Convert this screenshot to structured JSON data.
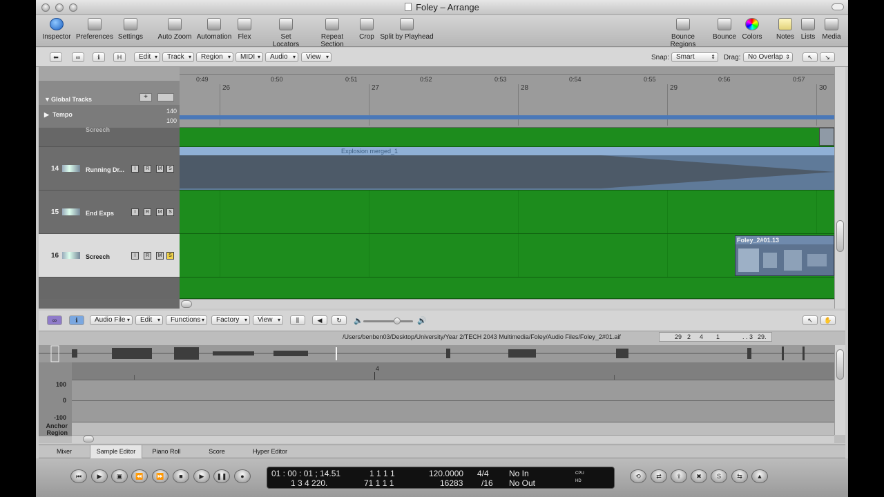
{
  "window": {
    "title": "Foley – Arrange"
  },
  "toolbar": {
    "items": [
      "Inspector",
      "Preferences",
      "Settings",
      "Auto Zoom",
      "Automation",
      "Flex",
      "Set Locators",
      "Repeat Section",
      "Crop",
      "Split by Playhead",
      "Bounce Regions",
      "Bounce",
      "Colors",
      "Notes",
      "Lists",
      "Media"
    ]
  },
  "arrange_menu": {
    "buttons": [
      "Edit",
      "Track",
      "Region",
      "MIDI",
      "Audio",
      "View"
    ],
    "small_buttons": [
      "⬅",
      "∞",
      "ℹ",
      "H"
    ],
    "snap_label": "Snap:",
    "snap_value": "Smart",
    "drag_label": "Drag:",
    "drag_value": "No Overlap"
  },
  "ruler": {
    "times": [
      "0:49",
      "0:50",
      "0:51",
      "0:52",
      "0:53",
      "0:54",
      "0:55",
      "0:56",
      "0:57"
    ],
    "bars": [
      "26",
      "27",
      "28",
      "29",
      "30"
    ]
  },
  "global_tracks": {
    "label": "Global Tracks",
    "tempo_label": "Tempo",
    "tempo_hi": "140",
    "tempo_lo": "100"
  },
  "tracks": [
    {
      "num": "14",
      "name": "Running Dr...",
      "buttons": [
        "I",
        "R",
        "M",
        "S"
      ]
    },
    {
      "num": "15",
      "name": "End Exps",
      "buttons": [
        "I",
        "R",
        "M",
        "S"
      ]
    },
    {
      "num": "16",
      "name": "Screech",
      "buttons": [
        "I",
        "R",
        "M",
        "S"
      ]
    }
  ],
  "partial_track_name": "Screech",
  "regions": {
    "explosion": "Explosion merged_1",
    "foley": "Foley_2#01.13"
  },
  "sample_editor": {
    "menus": [
      "Audio File",
      "Edit",
      "Functions",
      "Factory",
      "View"
    ],
    "path": "/Users/benben03/Desktop/University/Year 2/TECH 2043 Multimedia/Foley/Audio Files/Foley_2#01.aif",
    "position": [
      "29",
      "2",
      "4",
      "1",
      ". .",
      "3",
      "29."
    ],
    "ruler_mark": "4",
    "y_labels": [
      "100",
      "0",
      "-100"
    ],
    "bottom_labels": [
      "Anchor",
      "Region"
    ]
  },
  "tabs": [
    "Mixer",
    "Sample Editor",
    "Piano Roll",
    "Score",
    "Hyper Editor"
  ],
  "active_tab": "Sample Editor",
  "transport": {
    "smpte": "01 : 00 : 01 ; 14.51",
    "smpte_sub": "1    3    4  220.",
    "bars1": "1     1     1     1",
    "bars2": "71     1     1     1",
    "tempo": "120.0000",
    "tempo_sub": "16283",
    "sig": "4/4",
    "sig_sub": "/16",
    "in": "No In",
    "out": "No Out",
    "cpu": "CPU",
    "hd": "HD"
  }
}
